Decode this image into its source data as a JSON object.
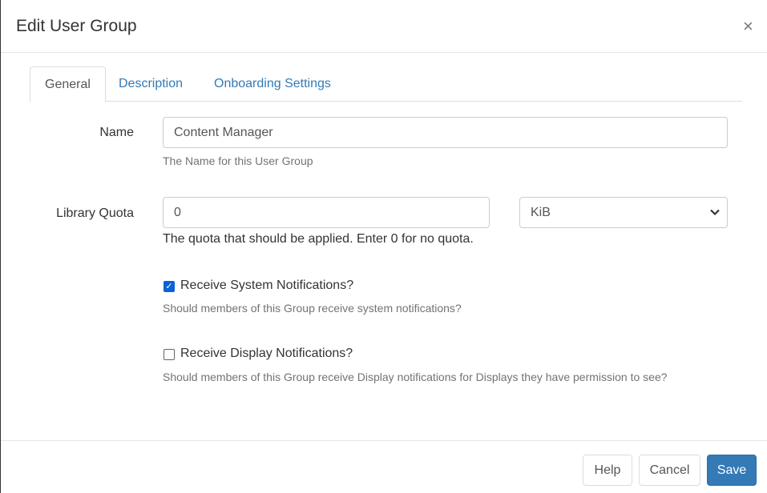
{
  "dialog": {
    "title": "Edit User Group",
    "close_label": "×"
  },
  "tabs": [
    {
      "label": "General",
      "active": true
    },
    {
      "label": "Description"
    },
    {
      "label": "Onboarding Settings"
    }
  ],
  "form": {
    "name": {
      "label": "Name",
      "value": "Content Manager",
      "help": "The Name for this User Group"
    },
    "quota": {
      "label": "Library Quota",
      "value": "0",
      "unit": "KiB",
      "help": "The quota that should be applied. Enter 0 for no quota."
    },
    "system_notifications": {
      "label": "Receive System Notifications?",
      "checked": true,
      "help": "Should members of this Group receive system notifications?"
    },
    "display_notifications": {
      "label": "Receive Display Notifications?",
      "checked": false,
      "help": "Should members of this Group receive Display notifications for Displays they have permission to see?"
    }
  },
  "footer": {
    "help": "Help",
    "cancel": "Cancel",
    "save": "Save"
  }
}
